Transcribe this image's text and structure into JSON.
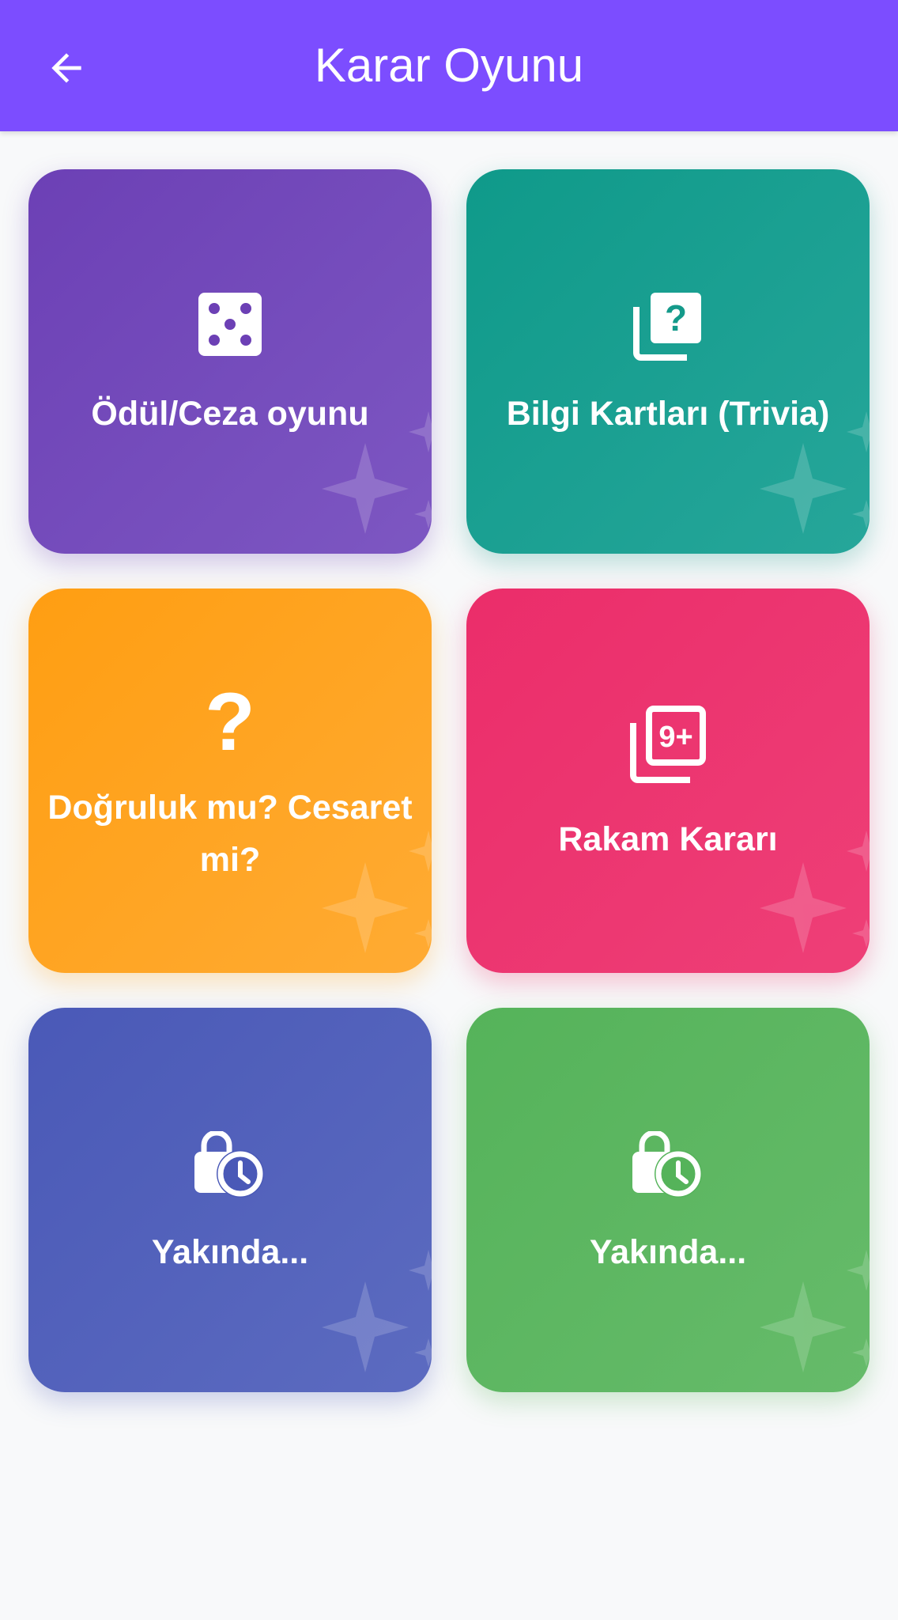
{
  "app_bar": {
    "title": "Karar Oyunu",
    "back_icon": "arrow-back-icon",
    "color": "#7c4dff"
  },
  "cards": [
    {
      "label": "Ödül/Ceza oyunu",
      "icon": "dice-five-icon",
      "color": "#6c40b5"
    },
    {
      "label": "Bilgi Kartları (Trivia)",
      "icon": "quiz-cards-icon",
      "color": "#149a8a"
    },
    {
      "label": "Doğruluk mu? Cesaret mi?",
      "icon": "question-mark-icon",
      "color": "#ffa01a"
    },
    {
      "label": "Rakam Kararı",
      "icon": "filter-9-plus-icon",
      "color": "#eb2d6a"
    },
    {
      "label": "Yakında...",
      "icon": "pending-lock-clock-icon",
      "color": "#4a59b7"
    },
    {
      "label": "Yakında...",
      "icon": "pending-lock-clock-icon",
      "color": "#55b35a"
    }
  ]
}
